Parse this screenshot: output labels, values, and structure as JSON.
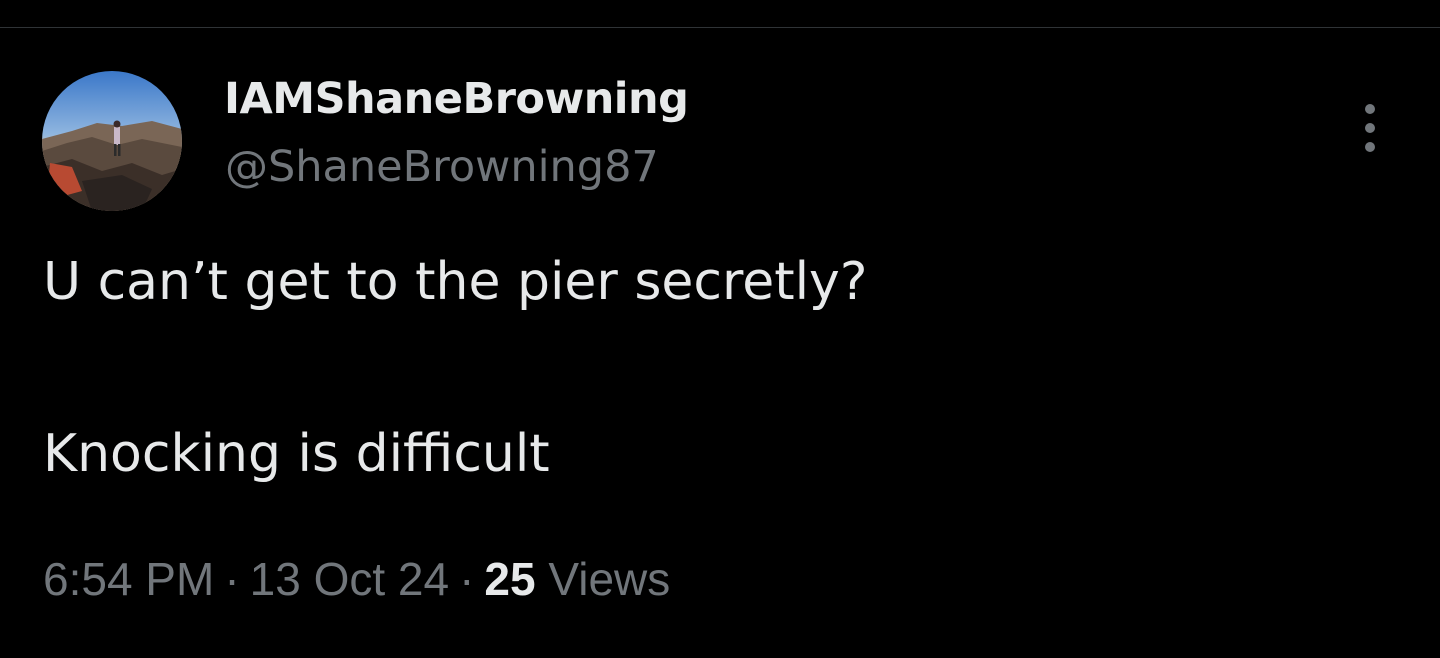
{
  "colors": {
    "background": "#000000",
    "primary_text": "#e7e9ea",
    "secondary_text": "#71767b",
    "divider": "#2f3336"
  },
  "author": {
    "display_name": "IAMShaneBrowning",
    "handle": "@ShaneBrowning87",
    "avatar_icon": "profile-photo-mountain-landscape"
  },
  "tweet": {
    "lines": [
      "U can’t get to the pier secretly?",
      "Knocking is difficult"
    ]
  },
  "meta": {
    "time": "6:54 PM",
    "separator": "·",
    "date": "13 Oct 24",
    "views_count": "25",
    "views_label": "Views"
  },
  "more_icon": "more-vertical-icon"
}
